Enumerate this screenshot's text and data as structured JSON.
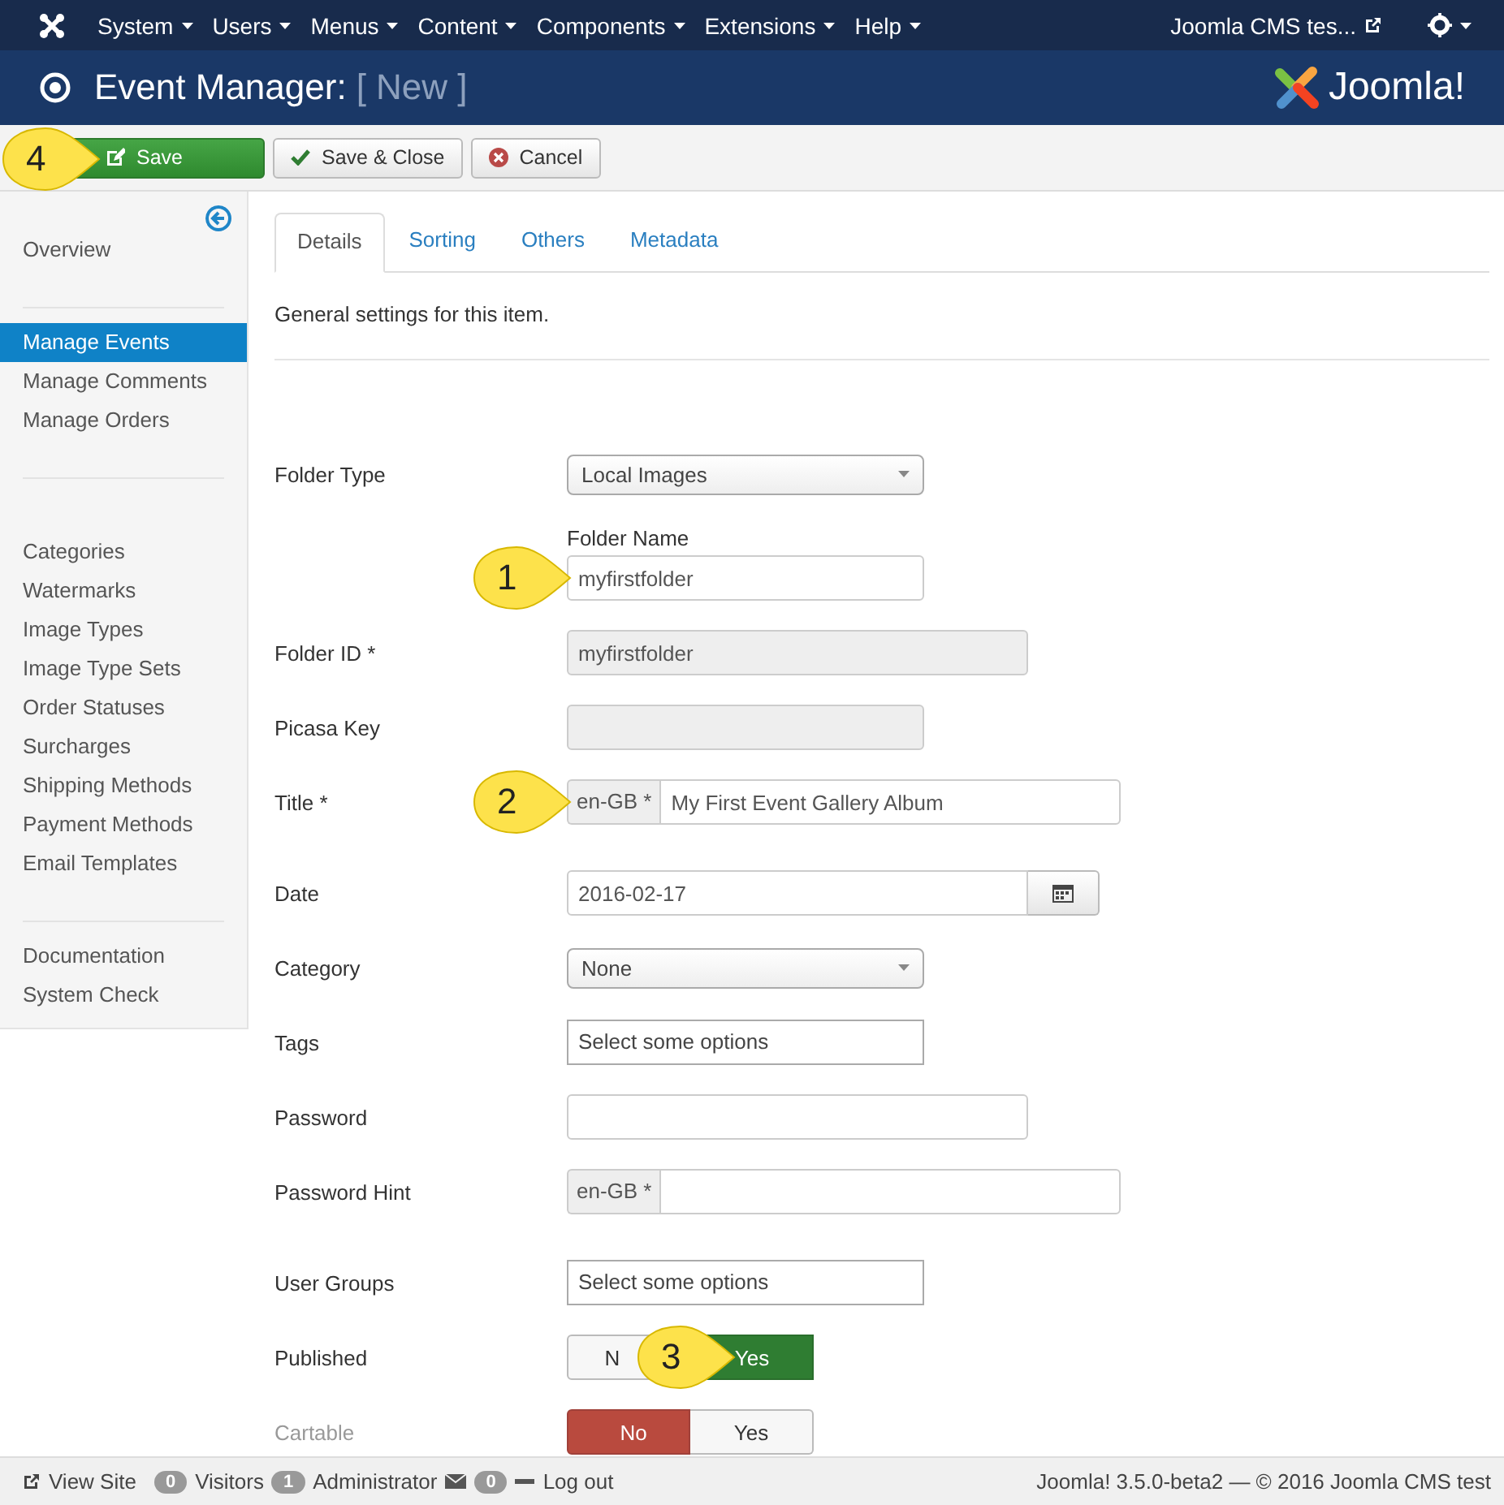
{
  "top_menu": {
    "items": [
      {
        "label": "System"
      },
      {
        "label": "Users"
      },
      {
        "label": "Menus"
      },
      {
        "label": "Content"
      },
      {
        "label": "Components"
      },
      {
        "label": "Extensions"
      },
      {
        "label": "Help"
      }
    ],
    "site_link": "Joomla CMS tes..."
  },
  "header": {
    "title": "Event Manager:",
    "subtitle": "[ New ]",
    "logo_text": "Joomla!"
  },
  "toolbar": [
    {
      "label": "Save",
      "kind": "save",
      "callout": "4"
    },
    {
      "label": "Save & Close",
      "kind": "check"
    },
    {
      "label": "Cancel",
      "kind": "cancel"
    }
  ],
  "sidebar": {
    "groups": [
      [
        {
          "label": "Overview",
          "selected": false
        }
      ],
      [
        {
          "label": "Manage Events",
          "selected": true
        },
        {
          "label": "Manage Comments",
          "selected": false
        },
        {
          "label": "Manage Orders",
          "selected": false
        }
      ],
      [
        {
          "label": "Categories",
          "selected": false
        },
        {
          "label": "Watermarks",
          "selected": false
        },
        {
          "label": "Image Types",
          "selected": false
        },
        {
          "label": "Image Type Sets",
          "selected": false
        },
        {
          "label": "Order Statuses",
          "selected": false
        },
        {
          "label": "Surcharges",
          "selected": false
        },
        {
          "label": "Shipping Methods",
          "selected": false
        },
        {
          "label": "Payment Methods",
          "selected": false
        },
        {
          "label": "Email Templates",
          "selected": false
        }
      ],
      [
        {
          "label": "Documentation",
          "selected": false
        },
        {
          "label": "System Check",
          "selected": false
        }
      ]
    ]
  },
  "tabs": [
    {
      "label": "Details",
      "selected": true
    },
    {
      "label": "Sorting",
      "selected": false
    },
    {
      "label": "Others",
      "selected": false
    },
    {
      "label": "Metadata",
      "selected": false
    }
  ],
  "description": "General settings for this item.",
  "fields": [
    {
      "kind": "select",
      "label": "Folder Type",
      "value": "Local Images"
    },
    {
      "kind": "stacked",
      "label": "Folder Name",
      "value": "myfirstfolder",
      "callout": "1"
    },
    {
      "kind": "readonly",
      "label": "Folder ID *",
      "value": "myfirstfolder"
    },
    {
      "kind": "readonly-short",
      "label": "Picasa Key"
    },
    {
      "kind": "lang",
      "label": "Title *",
      "lang": "en-GB *",
      "value": "My First Event Gallery Album",
      "callout": "2"
    },
    {
      "kind": "date",
      "label": "Date",
      "value": "2016-02-17"
    },
    {
      "kind": "select",
      "label": "Category",
      "value": "None"
    },
    {
      "kind": "tags",
      "label": "Tags",
      "placeholder": "Select some options"
    },
    {
      "kind": "password",
      "label": "Password"
    },
    {
      "kind": "lang",
      "label": "Password Hint",
      "lang": "en-GB *"
    },
    {
      "kind": "tags",
      "label": "User Groups",
      "placeholder": "Select some options"
    },
    {
      "kind": "toggle",
      "label": "Published",
      "disabled": false,
      "callout": "3",
      "options": [
        {
          "label": "N",
          "selected": false
        },
        {
          "label": "Yes",
          "selected": true
        }
      ]
    },
    {
      "kind": "toggle",
      "label": "Cartable",
      "disabled": true,
      "options": [
        {
          "label": "No",
          "selected": true
        },
        {
          "label": "Yes",
          "selected": false
        }
      ]
    }
  ],
  "status_bar": {
    "view_site": "View Site",
    "visitors_count": "0",
    "visitors": "Visitors",
    "admins_count": "1",
    "admins": "Administrator",
    "messages_count": "0",
    "logout": "Log out",
    "version": "Joomla! 3.5.0-beta2 — © 2016 Joomla CMS test"
  }
}
